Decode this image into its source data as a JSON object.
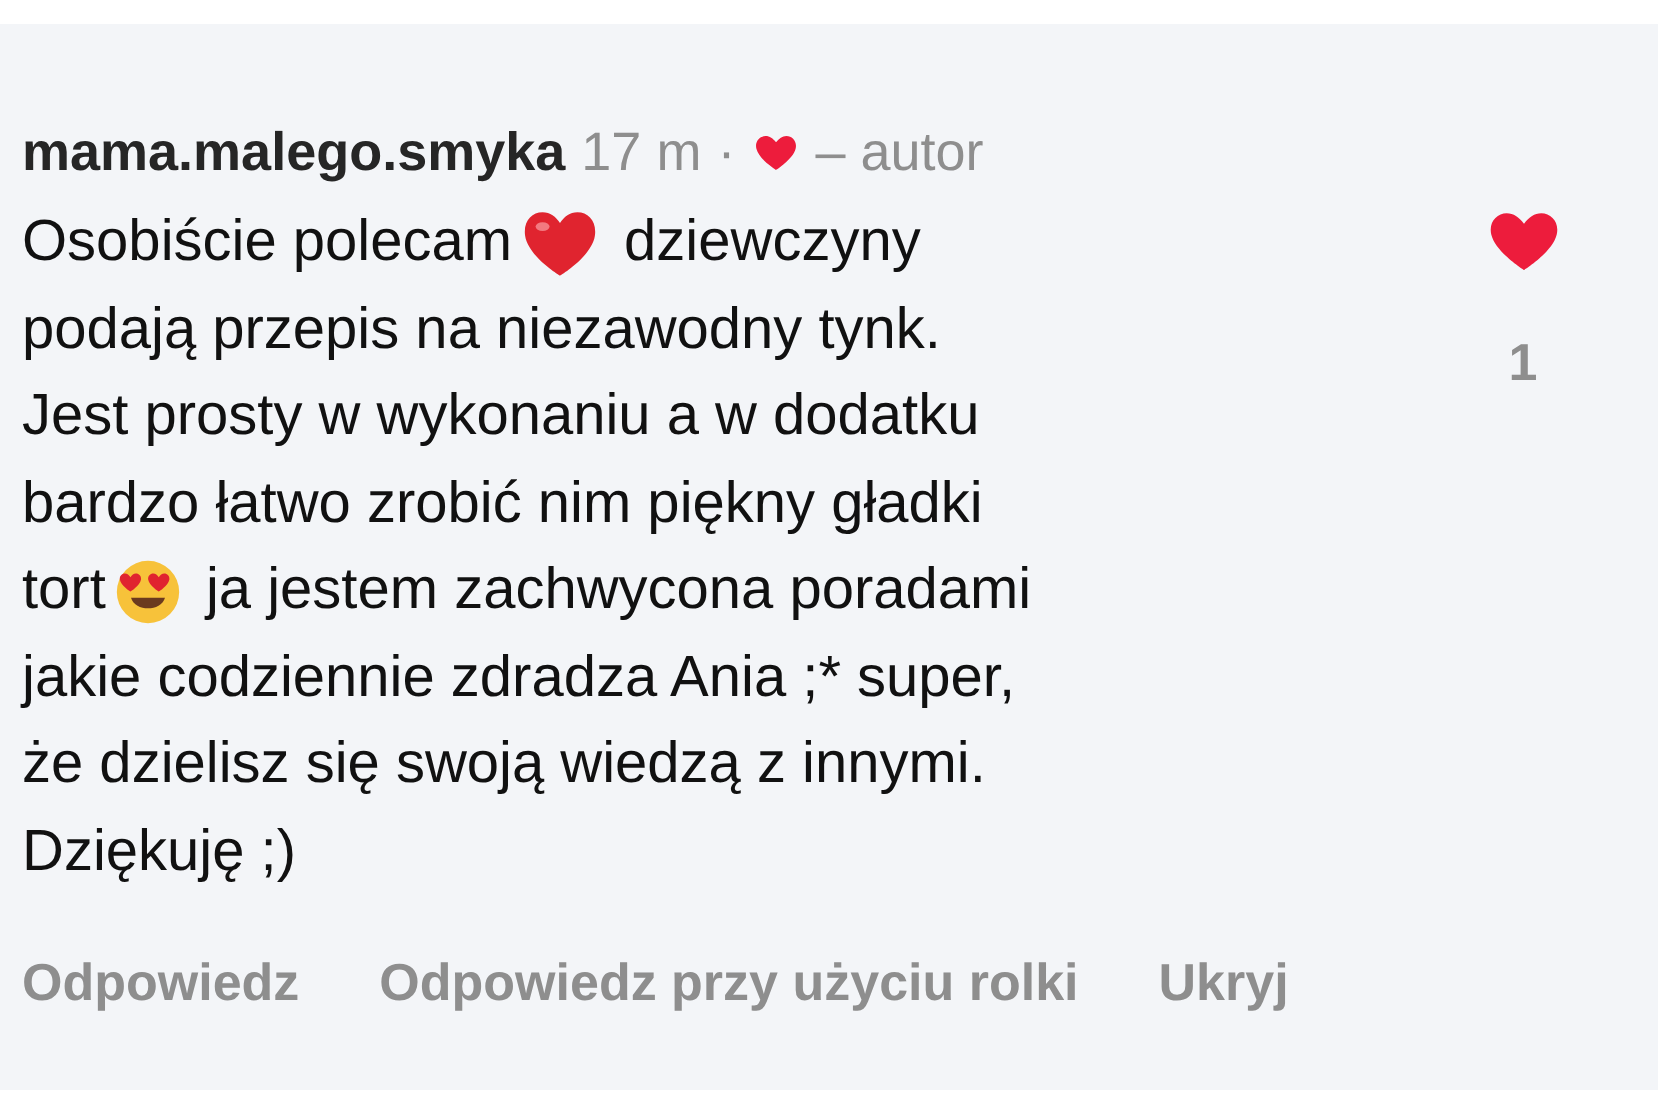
{
  "comment": {
    "username": "mama.malego.smyka",
    "time": "17 m",
    "separator": "·",
    "liked_by_author": true,
    "author_label": "– autor",
    "lines": [
      [
        {
          "kind": "text",
          "text": "Osobiście polecam"
        },
        {
          "kind": "heart"
        },
        {
          "kind": "text",
          "text": " dziewczyny"
        }
      ],
      [
        {
          "kind": "text",
          "text": "podają przepis na niezawodny tynk."
        }
      ],
      [
        {
          "kind": "text",
          "text": "Jest prosty w wykonaniu a w dodatku"
        }
      ],
      [
        {
          "kind": "text",
          "text": "bardzo łatwo zrobić nim piękny gładki"
        }
      ],
      [
        {
          "kind": "text",
          "text": "tort"
        },
        {
          "kind": "smiley"
        },
        {
          "kind": "text",
          "text": " ja jestem zachwycona poradami"
        }
      ],
      [
        {
          "kind": "text",
          "text": "jakie codziennie zdradza Ania ;* super,"
        }
      ],
      [
        {
          "kind": "text",
          "text": "że dzielisz się swoją wiedzą z innymi."
        }
      ],
      [
        {
          "kind": "text",
          "text": "Dziękuję ;)"
        }
      ]
    ],
    "like": {
      "liked": true,
      "count": "1"
    },
    "actions": [
      "Odpowiedz",
      "Odpowiedz przy użyciu rolki",
      "Ukryj"
    ]
  }
}
